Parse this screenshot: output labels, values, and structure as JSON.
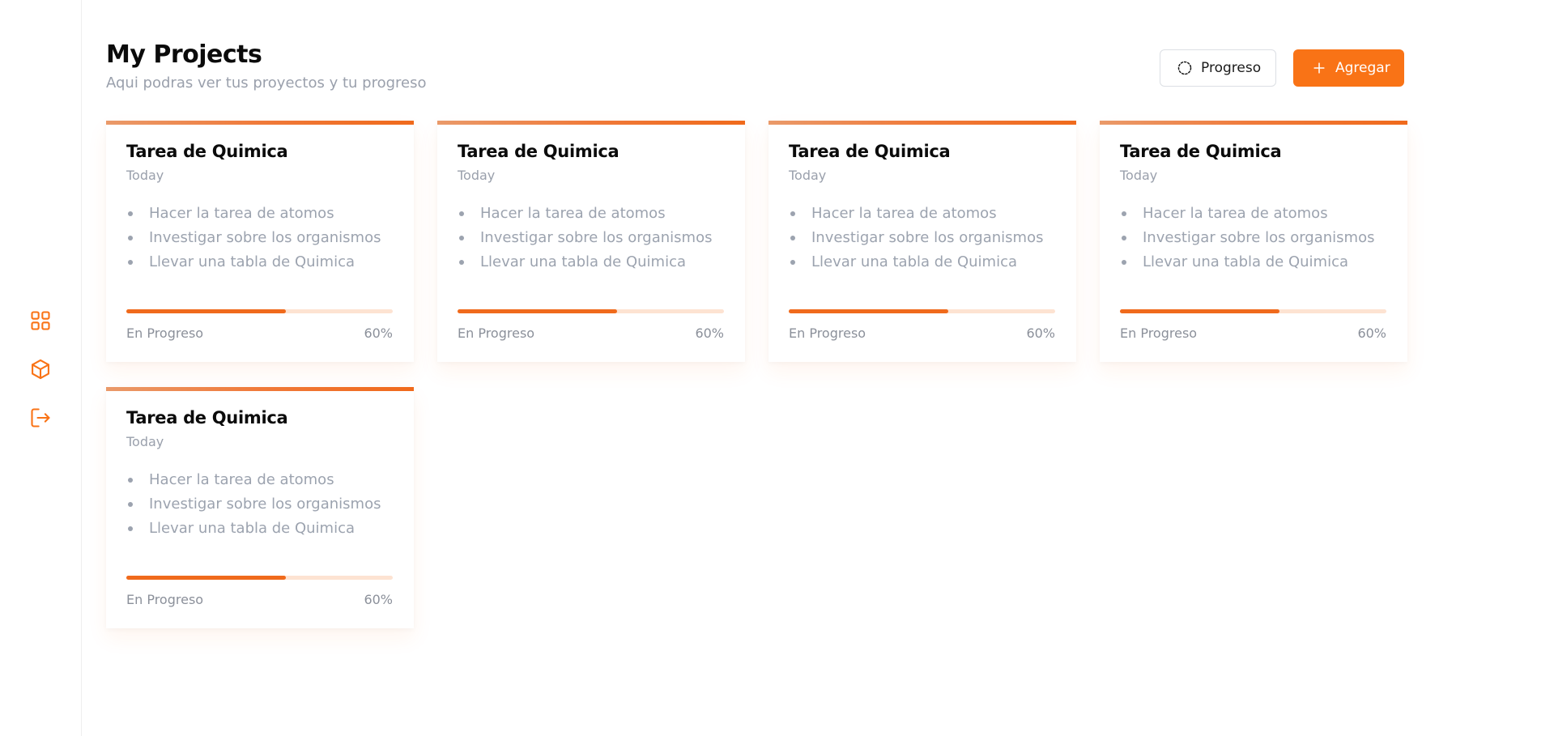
{
  "sidebar": {
    "items": [
      {
        "icon": "grid-icon"
      },
      {
        "icon": "box-icon"
      },
      {
        "icon": "logout-icon"
      }
    ],
    "accent": "#f97316"
  },
  "header": {
    "title": "My Projects",
    "subtitle": "Aqui podras ver tus proyectos y tu progreso"
  },
  "actions": {
    "progress_label": "Progreso",
    "add_label": "Agregar"
  },
  "colors": {
    "accent": "#f97316",
    "track": "#fde3d2",
    "muted_text": "#9aa0ac"
  },
  "cards": [
    {
      "title": "Tarea de Quimica",
      "date": "Today",
      "items": [
        "Hacer la tarea de atomos",
        "Investigar sobre los organismos",
        "Llevar una tabla de Quimica"
      ],
      "status": "En Progreso",
      "percent_label": "60%",
      "progress": 0.6
    },
    {
      "title": "Tarea de Quimica",
      "date": "Today",
      "items": [
        "Hacer la tarea de atomos",
        "Investigar sobre los organismos",
        "Llevar una tabla de Quimica"
      ],
      "status": "En Progreso",
      "percent_label": "60%",
      "progress": 0.6
    },
    {
      "title": "Tarea de Quimica",
      "date": "Today",
      "items": [
        "Hacer la tarea de atomos",
        "Investigar sobre los organismos",
        "Llevar una tabla de Quimica"
      ],
      "status": "En Progreso",
      "percent_label": "60%",
      "progress": 0.6
    },
    {
      "title": "Tarea de Quimica",
      "date": "Today",
      "items": [
        "Hacer la tarea de atomos",
        "Investigar sobre los organismos",
        "Llevar una tabla de Quimica"
      ],
      "status": "En Progreso",
      "percent_label": "60%",
      "progress": 0.6
    },
    {
      "title": "Tarea de Quimica",
      "date": "Today",
      "items": [
        "Hacer la tarea de atomos",
        "Investigar sobre los organismos",
        "Llevar una tabla de Quimica"
      ],
      "status": "En Progreso",
      "percent_label": "60%",
      "progress": 0.6
    }
  ]
}
